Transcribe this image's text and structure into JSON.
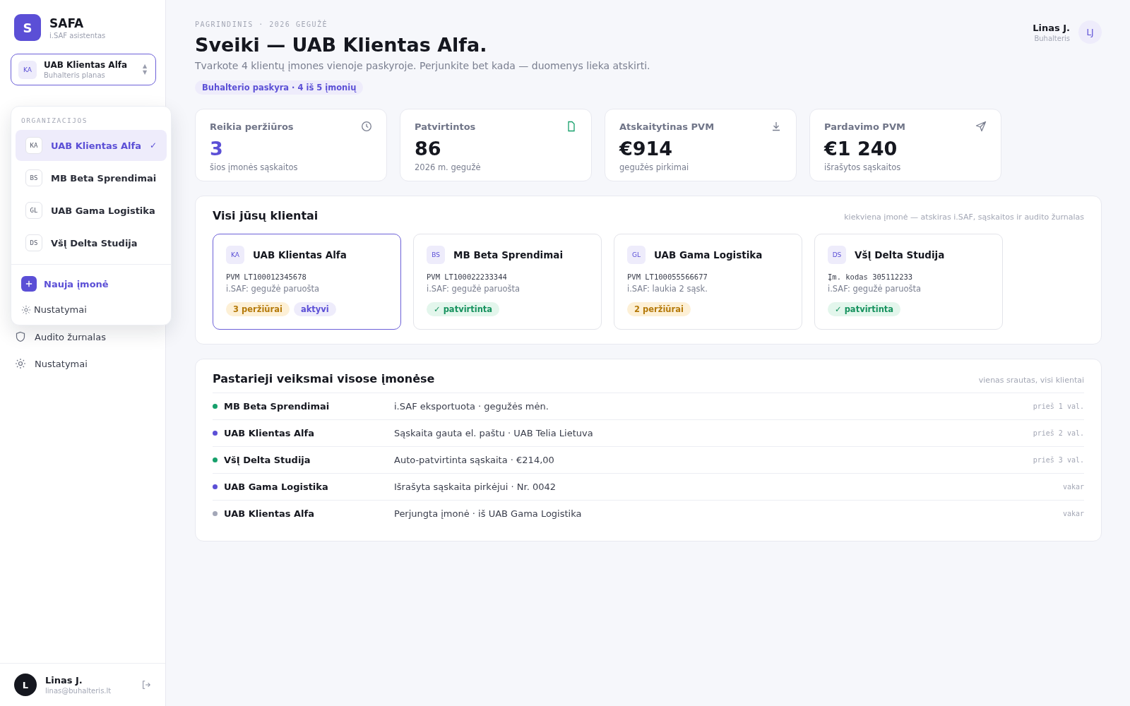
{
  "brand": {
    "logo": "S",
    "name": "SAFA",
    "subtitle": "i.SAF asistentas"
  },
  "switcher": {
    "initials": "KA",
    "name": "UAB Klientas Alfa",
    "plan": "Buhalteris planas",
    "arrows": "▲▼"
  },
  "dropdown": {
    "heading": "ORGANIZACIJOS",
    "items": [
      {
        "initials": "KA",
        "name": "UAB Klientas Alfa",
        "selected": true,
        "check": "✓"
      },
      {
        "initials": "BS",
        "name": "MB Beta Sprendimai",
        "selected": false
      },
      {
        "initials": "GL",
        "name": "UAB Gama Logistika",
        "selected": false
      },
      {
        "initials": "DS",
        "name": "VšĮ Delta Studija",
        "selected": false
      }
    ],
    "new_label": "Nauja įmonė",
    "settings_label": "Nustatymai"
  },
  "sidebar": {
    "items": [
      {
        "label": "Audito žurnalas"
      },
      {
        "label": "Nustatymai"
      }
    ]
  },
  "user": {
    "initial": "L",
    "name": "Linas J.",
    "email": "linas@buhalteris.lt"
  },
  "header": {
    "eyebrow": "PAGRINDINIS · 2026 GEGUŽĖ",
    "title": "Sveiki — UAB Klientas Alfa.",
    "subtitle": "Tvarkote 4 klientų įmones vienoje paskyroje. Perjunkite bet kada — duomenys lieka atskirti.",
    "badge": "Buhalterio paskyra · 4 iš 5 įmonių"
  },
  "profile": {
    "name": "Linas J.",
    "role": "Buhalteris",
    "initials": "LJ"
  },
  "stats": [
    {
      "label": "Reikia peržiūros",
      "value": "3",
      "note": "šios įmonės sąskaitos",
      "highlighted": true
    },
    {
      "label": "Patvirtintos",
      "value": "86",
      "note": "2026 m. gegužė",
      "highlighted": false
    },
    {
      "label": "Atskaitytinas PVM",
      "value": "€914",
      "note": "gegužės pirkimai",
      "highlighted": false
    },
    {
      "label": "Pardavimo PVM",
      "value": "€1 240",
      "note": "išrašytos sąskaitos",
      "highlighted": false
    }
  ],
  "clients": {
    "title": "Visi jūsų klientai",
    "hint": "kiekviena įmonė — atskiras i.SAF, sąskaitos ir audito žurnalas",
    "items": [
      {
        "initials": "KA",
        "name": "UAB Klientas Alfa",
        "code": "PVM LT100012345678",
        "status": "i.SAF: gegužė paruošta",
        "selected": true,
        "tags": [
          {
            "text": "3 peržiūrai",
            "kind": "warning"
          },
          {
            "text": "aktyvi",
            "kind": "active"
          }
        ]
      },
      {
        "initials": "BS",
        "name": "MB Beta Sprendimai",
        "code": "PVM LT100022233344",
        "status": "i.SAF: gegužė paruošta",
        "selected": false,
        "tags": [
          {
            "text": "✓ patvirtinta",
            "kind": "success"
          }
        ]
      },
      {
        "initials": "GL",
        "name": "UAB Gama Logistika",
        "code": "PVM LT100055566677",
        "status": "i.SAF: laukia 2 sąsk.",
        "selected": false,
        "tags": [
          {
            "text": "2 peržiūrai",
            "kind": "warning"
          }
        ]
      },
      {
        "initials": "DS",
        "name": "VšĮ Delta Studija",
        "code": "Įm. kodas 305112233",
        "status": "i.SAF: gegužė paruošta",
        "selected": false,
        "tags": [
          {
            "text": "✓ patvirtinta",
            "kind": "success"
          }
        ]
      }
    ]
  },
  "activity": {
    "title": "Pastarieji veiksmai visose įmonėse",
    "hint": "vienas srautas, visi klientai",
    "rows": [
      {
        "company": "MB Beta Sprendimai",
        "action": "i.SAF eksportuota · gegužės mėn.",
        "time": "prieš 1 val.",
        "color": "#16a06b"
      },
      {
        "company": "UAB Klientas Alfa",
        "action": "Sąskaita gauta el. paštu · UAB Telia Lietuva",
        "time": "prieš 2 val.",
        "color": "#5b4fd6"
      },
      {
        "company": "VšĮ Delta Studija",
        "action": "Auto-patvirtinta sąskaita · €214,00",
        "time": "prieš 3 val.",
        "color": "#16a06b"
      },
      {
        "company": "UAB Gama Logistika",
        "action": "Išrašyta sąskaita pirkėjui · Nr. 0042",
        "time": "vakar",
        "color": "#5b4fd6"
      },
      {
        "company": "UAB Klientas Alfa",
        "action": "Perjungta įmonė · iš UAB Gama Logistika",
        "time": "vakar",
        "color": "#a3a7b8"
      }
    ]
  }
}
